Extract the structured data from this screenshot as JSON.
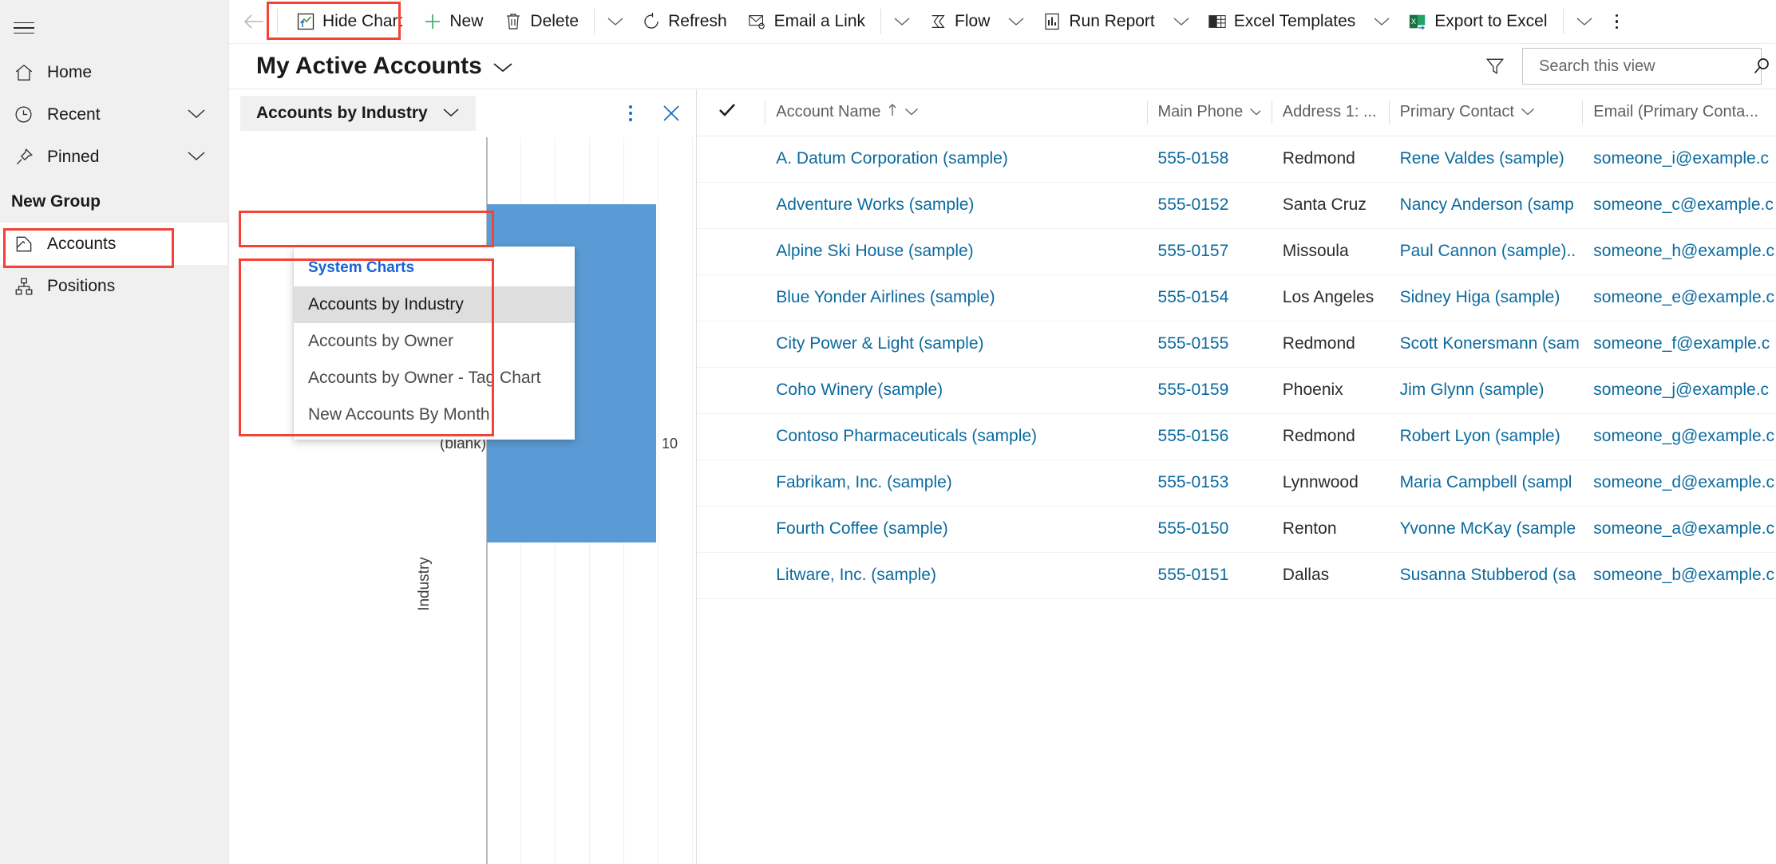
{
  "sidebar": {
    "menu_icon": "hamburger-icon",
    "items": [
      {
        "label": "Home",
        "icon": "home-icon",
        "chevron": false
      },
      {
        "label": "Recent",
        "icon": "clock-icon",
        "chevron": true
      },
      {
        "label": "Pinned",
        "icon": "pin-icon",
        "chevron": true
      }
    ],
    "group_title": "New Group",
    "group_items": [
      {
        "label": "Accounts",
        "icon": "accounts-icon",
        "selected": true
      },
      {
        "label": "Positions",
        "icon": "positions-icon",
        "selected": false
      }
    ]
  },
  "commandbar": {
    "back_icon": "back-arrow-icon",
    "buttons": [
      {
        "label": "Hide Chart",
        "icon": "chart-icon",
        "caret": false,
        "highlighted": true
      },
      {
        "label": "New",
        "icon": "plus-icon",
        "caret": false
      },
      {
        "label": "Delete",
        "icon": "trash-icon",
        "caret": true
      },
      {
        "label": "Refresh",
        "icon": "refresh-icon",
        "caret": false
      },
      {
        "label": "Email a Link",
        "icon": "email-link-icon",
        "caret": true
      },
      {
        "label": "Flow",
        "icon": "flow-icon",
        "caret": true
      },
      {
        "label": "Run Report",
        "icon": "report-icon",
        "caret": true
      },
      {
        "label": "Excel Templates",
        "icon": "excel-template-icon",
        "caret": true
      },
      {
        "label": "Export to Excel",
        "icon": "excel-export-icon",
        "caret": true
      }
    ],
    "overflow_icon": "more-vertical-icon"
  },
  "view": {
    "title": "My Active Accounts",
    "title_chevron_icon": "chevron-down-icon",
    "filter_icon": "filter-icon",
    "search": {
      "placeholder": "Search this view",
      "value": "",
      "icon": "search-icon"
    }
  },
  "chart_panel": {
    "selector_label": "Accounts by Industry",
    "selector_chevron_icon": "chevron-down-icon",
    "kebab_icon": "more-vertical-icon",
    "close_icon": "close-icon",
    "menu": {
      "group_label": "System Charts",
      "items": [
        {
          "label": "Accounts by Industry",
          "active": true
        },
        {
          "label": "Accounts by Owner",
          "active": false
        },
        {
          "label": "Accounts by Owner - Tag Chart",
          "active": false
        },
        {
          "label": "New Accounts By Month",
          "active": false
        }
      ]
    }
  },
  "chart_data": {
    "type": "bar",
    "orientation": "horizontal",
    "title": "",
    "categories": [
      "(blank)"
    ],
    "values": [
      10
    ],
    "data_labels": [
      "10"
    ],
    "xlabel": "",
    "ylabel": "Industry",
    "xlim": [
      0,
      12
    ],
    "grid": true,
    "gridline_count": 5,
    "bar_color": "#5b9bd5",
    "legend": "none"
  },
  "grid": {
    "select_all_icon": "checkmark-icon",
    "columns": [
      {
        "key": "name",
        "label": "Account Name",
        "sort_icon": "sort-asc-icon",
        "caret": true
      },
      {
        "key": "phone",
        "label": "Main Phone",
        "sort_icon": "",
        "caret": true
      },
      {
        "key": "address",
        "label": "Address 1: ...",
        "sort_icon": "",
        "caret": true
      },
      {
        "key": "contact",
        "label": "Primary Contact",
        "sort_icon": "",
        "caret": true
      },
      {
        "key": "email",
        "label": "Email (Primary Conta...",
        "sort_icon": "",
        "caret": true
      }
    ],
    "rows": [
      {
        "name": "A. Datum Corporation (sample)",
        "phone": "555-0158",
        "address": "Redmond",
        "contact": "Rene Valdes (sample)",
        "email": "someone_i@example.c"
      },
      {
        "name": "Adventure Works (sample)",
        "phone": "555-0152",
        "address": "Santa Cruz",
        "contact": "Nancy Anderson (samp",
        "email": "someone_c@example.c"
      },
      {
        "name": "Alpine Ski House (sample)",
        "phone": "555-0157",
        "address": "Missoula",
        "contact": "Paul Cannon (sample)..",
        "email": "someone_h@example.c"
      },
      {
        "name": "Blue Yonder Airlines (sample)",
        "phone": "555-0154",
        "address": "Los Angeles",
        "contact": "Sidney Higa (sample)",
        "email": "someone_e@example.c"
      },
      {
        "name": "City Power & Light (sample)",
        "phone": "555-0155",
        "address": "Redmond",
        "contact": "Scott Konersmann (sam",
        "email": "someone_f@example.c"
      },
      {
        "name": "Coho Winery (sample)",
        "phone": "555-0159",
        "address": "Phoenix",
        "contact": "Jim Glynn (sample)",
        "email": "someone_j@example.c"
      },
      {
        "name": "Contoso Pharmaceuticals (sample)",
        "phone": "555-0156",
        "address": "Redmond",
        "contact": "Robert Lyon (sample)",
        "email": "someone_g@example.c"
      },
      {
        "name": "Fabrikam, Inc. (sample)",
        "phone": "555-0153",
        "address": "Lynnwood",
        "contact": "Maria Campbell (sampl",
        "email": "someone_d@example.c"
      },
      {
        "name": "Fourth Coffee (sample)",
        "phone": "555-0150",
        "address": "Renton",
        "contact": "Yvonne McKay (sample",
        "email": "someone_a@example.c"
      },
      {
        "name": "Litware, Inc. (sample)",
        "phone": "555-0151",
        "address": "Dallas",
        "contact": "Susanna Stubberod (sa",
        "email": "someone_b@example.c"
      }
    ]
  },
  "annotations": {
    "highlight_color": "#f44336",
    "boxes": [
      "hide-chart-button",
      "accounts-sidebar-item",
      "chart-selector",
      "chart-menu"
    ]
  }
}
